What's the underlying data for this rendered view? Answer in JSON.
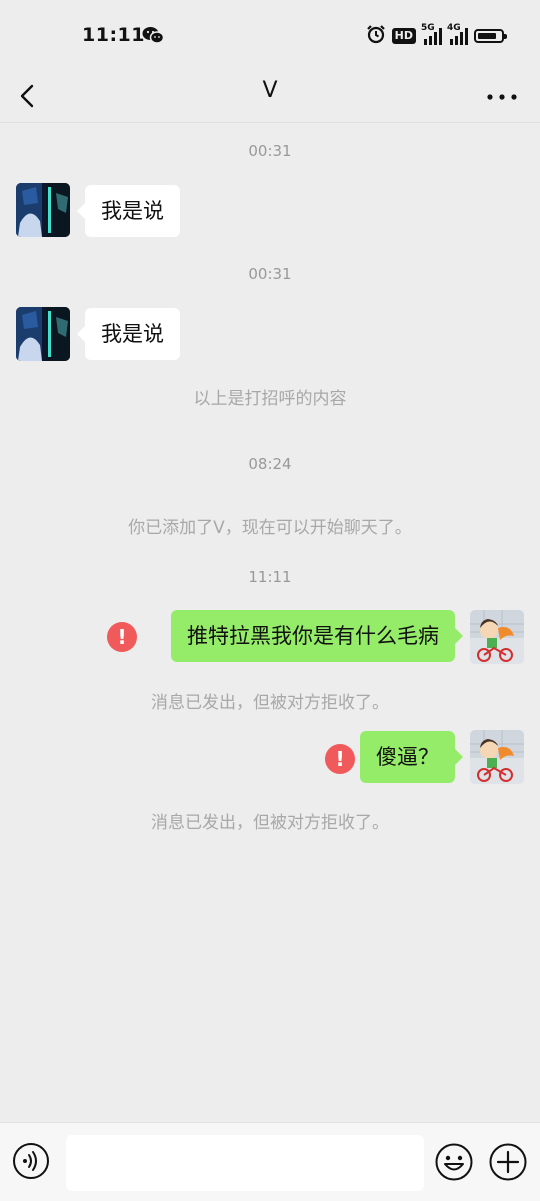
{
  "status_bar": {
    "time": "11:11",
    "net1": "5G",
    "net2": "4G",
    "hd": "HD",
    "battery_level": 0.85,
    "icons": [
      "wechat-icon",
      "alarm-icon",
      "hd-icon",
      "signal-5g-icon",
      "signal-4g-icon",
      "battery-icon"
    ]
  },
  "header": {
    "title": "V",
    "back_icon": "chevron-left-icon",
    "more_icon": "more-icon"
  },
  "messages": [
    {
      "type": "time",
      "text": "00:31"
    },
    {
      "type": "incoming",
      "text": "我是说"
    },
    {
      "type": "time",
      "text": "00:31"
    },
    {
      "type": "incoming",
      "text": "我是说"
    },
    {
      "type": "system",
      "text": "以上是打招呼的内容"
    },
    {
      "type": "time",
      "text": "08:24"
    },
    {
      "type": "system",
      "text": "你已添加了V，现在可以开始聊天了。"
    },
    {
      "type": "time",
      "text": "11:11"
    },
    {
      "type": "outgoing",
      "text": "推特拉黑我你是有什么毛病",
      "status": "!"
    },
    {
      "type": "system",
      "text": "消息已发出，但被对方拒收了。"
    },
    {
      "type": "outgoing",
      "text": "傻逼？",
      "status": "!"
    },
    {
      "type": "system",
      "text": "消息已发出，但被对方拒收了。"
    }
  ],
  "input_bar": {
    "voice_icon": "voice-icon",
    "emoji_icon": "emoji-icon",
    "plus_icon": "plus-icon",
    "value": "",
    "placeholder": ""
  },
  "colors": {
    "background": "#EDEDED",
    "outgoing_bubble": "#95EC69",
    "incoming_bubble": "#FFFFFF",
    "error": "#F05A5A",
    "muted_text": "#A8A8A8"
  }
}
